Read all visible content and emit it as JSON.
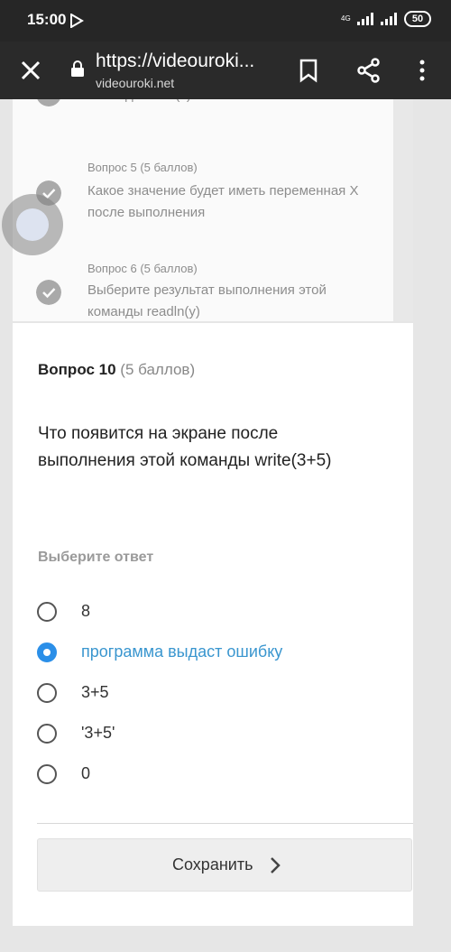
{
  "status_bar": {
    "time": "15:00",
    "network": "4G",
    "battery": "50"
  },
  "browser": {
    "url": "https://videouroki...",
    "domain": "videouroki.net",
    "icons": [
      "close-icon",
      "lock-icon",
      "bookmark-icon",
      "share-icon",
      "more-vert-icon"
    ]
  },
  "question_list": {
    "items": [
      {
        "text": "команды write(x)"
      },
      {
        "header": "Вопрос 5 (5 баллов)",
        "text": "Какое значение будет иметь переменная X после выполнения"
      },
      {
        "header": "Вопрос 6 (5 баллов)",
        "text": "Выберите результат выполнения этой команды readln(y)"
      }
    ]
  },
  "question": {
    "title": "Вопрос 10",
    "points": "(5 баллов)",
    "text": "Что появится на экране после выполнения этой команды write(3+5)",
    "choose_label": "Выберите ответ",
    "options": [
      {
        "label": "8",
        "selected": false
      },
      {
        "label": "программа выдаст ошибку",
        "selected": true
      },
      {
        "label": "3+5",
        "selected": false
      },
      {
        "label": "'3+5'",
        "selected": false
      },
      {
        "label": "0",
        "selected": false
      }
    ],
    "save_label": "Сохранить"
  },
  "colors": {
    "accent": "#2b8fe8",
    "selected_text": "#3a96cf",
    "toolbar": "#2a2a2a"
  }
}
